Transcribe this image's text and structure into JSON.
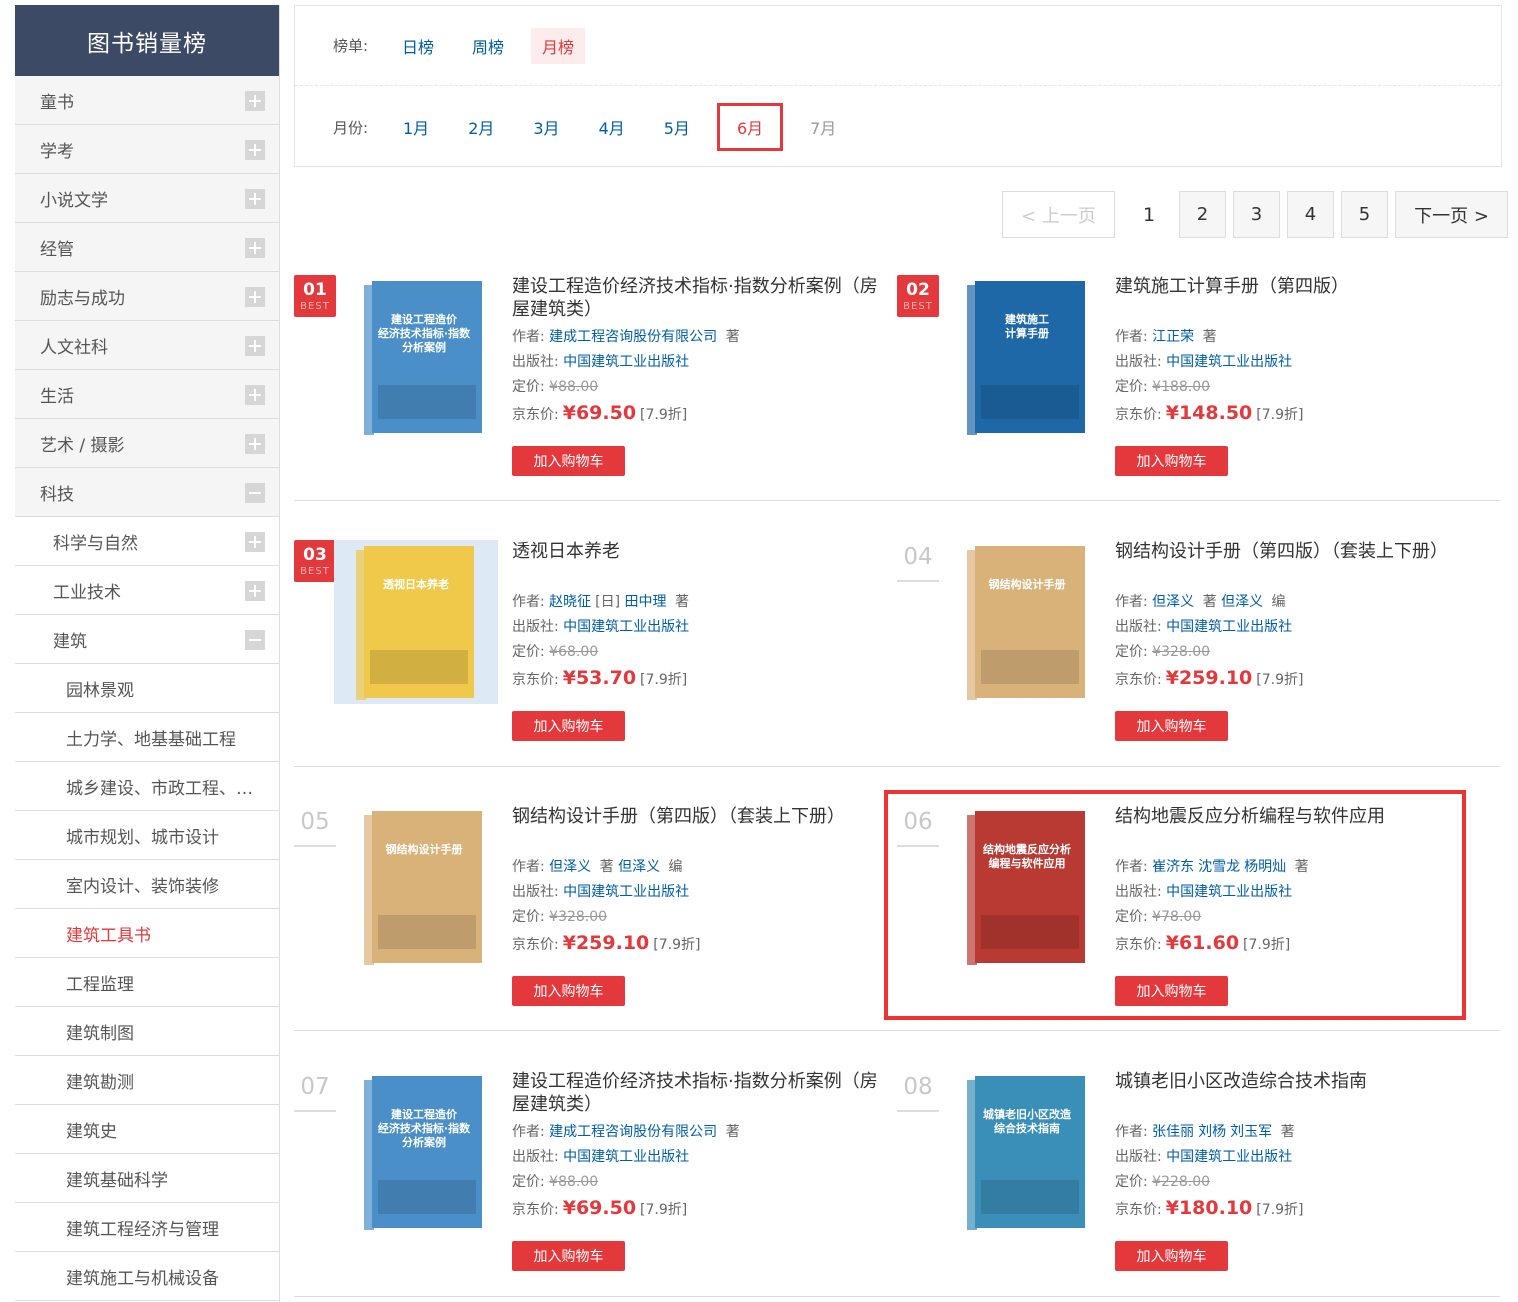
{
  "sidebar": {
    "title": "图书销量榜",
    "items": [
      {
        "label": "童书",
        "level": 1,
        "toggle": "plus"
      },
      {
        "label": "学考",
        "level": 1,
        "toggle": "plus"
      },
      {
        "label": "小说文学",
        "level": 1,
        "toggle": "plus"
      },
      {
        "label": "经管",
        "level": 1,
        "toggle": "plus"
      },
      {
        "label": "励志与成功",
        "level": 1,
        "toggle": "plus"
      },
      {
        "label": "人文社科",
        "level": 1,
        "toggle": "plus"
      },
      {
        "label": "生活",
        "level": 1,
        "toggle": "plus"
      },
      {
        "label": "艺术 / 摄影",
        "level": 1,
        "toggle": "plus"
      },
      {
        "label": "科技",
        "level": 1,
        "toggle": "minus"
      },
      {
        "label": "科学与自然",
        "level": 2,
        "toggle": "plus"
      },
      {
        "label": "工业技术",
        "level": 2,
        "toggle": "plus"
      },
      {
        "label": "建筑",
        "level": 2,
        "toggle": "minus"
      },
      {
        "label": "园林景观",
        "level": 3
      },
      {
        "label": "土力学、地基基础工程",
        "level": 3
      },
      {
        "label": "城乡建设、市政工程、…",
        "level": 3
      },
      {
        "label": "城市规划、城市设计",
        "level": 3
      },
      {
        "label": "室内设计、装饰装修",
        "level": 3
      },
      {
        "label": "建筑工具书",
        "level": 3,
        "active": true
      },
      {
        "label": "工程监理",
        "level": 3
      },
      {
        "label": "建筑制图",
        "level": 3
      },
      {
        "label": "建筑勘测",
        "level": 3
      },
      {
        "label": "建筑史",
        "level": 3
      },
      {
        "label": "建筑基础科学",
        "level": 3
      },
      {
        "label": "建筑工程经济与管理",
        "level": 3
      },
      {
        "label": "建筑施工与机械设备",
        "level": 3
      }
    ]
  },
  "filter": {
    "list_label": "榜单:",
    "lists": [
      "日榜",
      "周榜",
      "月榜"
    ],
    "list_selected": 2,
    "month_label": "月份:",
    "months": [
      "1月",
      "2月",
      "3月",
      "4月",
      "5月",
      "6月",
      "7月"
    ],
    "month_selected": 5,
    "month_disabled": 6
  },
  "pager": {
    "prev": "< 上一页",
    "current": "1",
    "pages": [
      "2",
      "3",
      "4",
      "5"
    ],
    "next": "下一页 >"
  },
  "labels": {
    "author": "作者:",
    "publisher": "出版社:",
    "list_price": "定价:",
    "jd_price": "京东价:",
    "add_cart": "加入购物车",
    "best": "BEST"
  },
  "colors": {
    "accent": "#e4393c",
    "link": "#005ea7",
    "sidebar_head": "#3d4a66"
  },
  "products": [
    {
      "rank": "01",
      "title": "建设工程造价经济技术指标·指数分析案例（房屋建筑类）",
      "authors": [
        "建成工程咨询股份有限公司"
      ],
      "author_role": "著",
      "publisher": "中国建筑工业出版社",
      "list_price": "¥88.00",
      "jd_price": "¥69.50",
      "discount": "[7.9折]",
      "cover_color": "#4a8fc8",
      "cover_title": "建设工程造价 经济技术指标·指数 分析案例"
    },
    {
      "rank": "02",
      "title": "建筑施工计算手册（第四版）",
      "authors": [
        "江正荣"
      ],
      "author_role": "著",
      "publisher": "中国建筑工业出版社",
      "list_price": "¥188.00",
      "jd_price": "¥148.50",
      "discount": "[7.9折]",
      "cover_color": "#1f68a8",
      "cover_title": "建筑施工 计算手册"
    },
    {
      "rank": "03",
      "title": "透视日本养老",
      "author_line": [
        "赵晓征",
        "[日]",
        "田中理"
      ],
      "author_role": "著",
      "publisher": "中国建筑工业出版社",
      "list_price": "¥68.00",
      "jd_price": "¥53.70",
      "discount": "[7.9折]",
      "cover_color": "#f0c84a",
      "cover_title": "透视日本养老"
    },
    {
      "rank": "04",
      "title": "钢结构设计手册（第四版）（套装上下册）",
      "authors": [
        "但泽义"
      ],
      "author_role": "著",
      "editors": [
        "但泽义"
      ],
      "editor_role": "编",
      "publisher": "中国建筑工业出版社",
      "list_price": "¥328.00",
      "jd_price": "¥259.10",
      "discount": "[7.9折]",
      "cover_color": "#d9b27a",
      "cover_title": "钢结构设计手册"
    },
    {
      "rank": "05",
      "title": "钢结构设计手册（第四版）（套装上下册）",
      "authors": [
        "但泽义"
      ],
      "author_role": "著",
      "editors": [
        "但泽义"
      ],
      "editor_role": "编",
      "publisher": "中国建筑工业出版社",
      "list_price": "¥328.00",
      "jd_price": "¥259.10",
      "discount": "[7.9折]",
      "cover_color": "#d9b27a",
      "cover_title": "钢结构设计手册"
    },
    {
      "rank": "06",
      "title": "结构地震反应分析编程与软件应用",
      "authors": [
        "崔济东",
        "沈雪龙",
        "杨明灿"
      ],
      "author_role": "著",
      "publisher": "中国建筑工业出版社",
      "list_price": "¥78.00",
      "jd_price": "¥61.60",
      "discount": "[7.9折]",
      "cover_color": "#b83a32",
      "cover_title": "结构地震反应分析 编程与软件应用"
    },
    {
      "rank": "07",
      "title": "建设工程造价经济技术指标·指数分析案例（房屋建筑类）",
      "authors": [
        "建成工程咨询股份有限公司"
      ],
      "author_role": "著",
      "publisher": "中国建筑工业出版社",
      "list_price": "¥88.00",
      "jd_price": "¥69.50",
      "discount": "[7.9折]",
      "cover_color": "#4a8fc8",
      "cover_title": "建设工程造价 经济技术指标·指数 分析案例"
    },
    {
      "rank": "08",
      "title": "城镇老旧小区改造综合技术指南",
      "authors": [
        "张佳丽",
        "刘杨",
        "刘玉军"
      ],
      "author_role": "著",
      "publisher": "中国建筑工业出版社",
      "list_price": "¥228.00",
      "jd_price": "¥180.10",
      "discount": "[7.9折]",
      "cover_color": "#3a8fb8",
      "cover_title": "城镇老旧小区改造 综合技术指南"
    }
  ]
}
